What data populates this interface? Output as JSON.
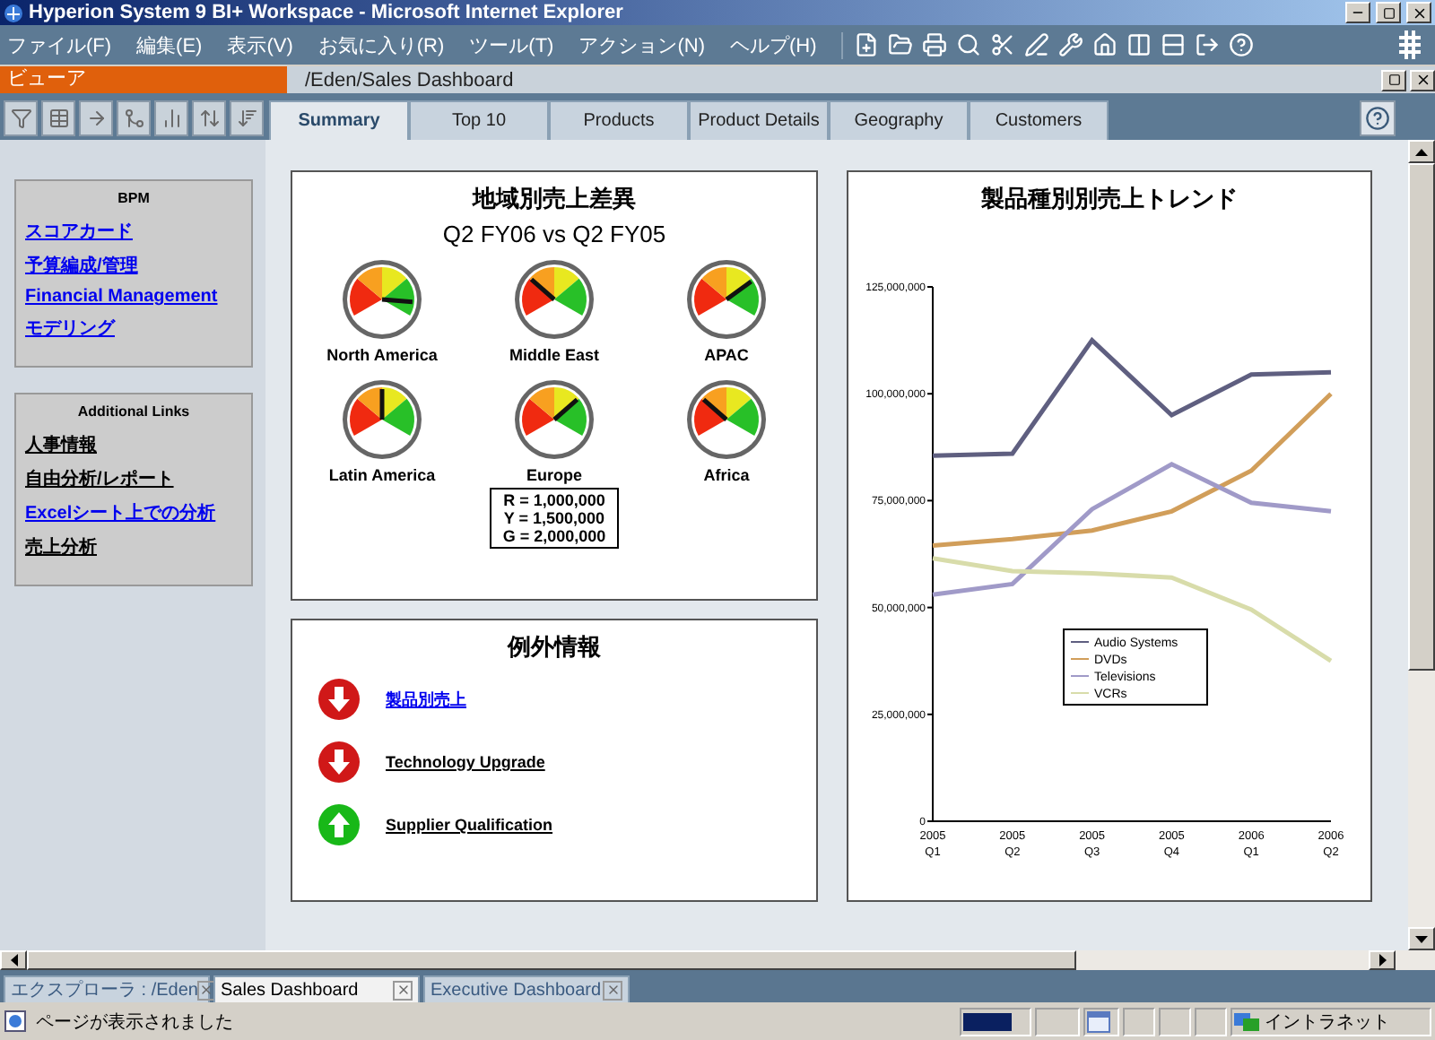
{
  "window": {
    "title": "Hyperion System 9 BI+ Workspace - Microsoft Internet Explorer"
  },
  "menu": [
    "ファイル(F)",
    "編集(E)",
    "表示(V)",
    "お気に入り(R)",
    "ツール(T)",
    "アクション(N)",
    "ヘルプ(H)"
  ],
  "viewer": {
    "label": "ビューア",
    "path": "/Eden/Sales Dashboard"
  },
  "tabs": [
    {
      "label": "Summary",
      "selected": true
    },
    {
      "label": "Top 10",
      "selected": false
    },
    {
      "label": "Products",
      "selected": false
    },
    {
      "label": "Product Details",
      "selected": false
    },
    {
      "label": "Geography",
      "selected": false
    },
    {
      "label": "Customers",
      "selected": false
    }
  ],
  "sidebar": [
    {
      "title": "BPM",
      "links": [
        {
          "label": "スコアカード",
          "color": "#0000ee"
        },
        {
          "label": "予算編成/管理",
          "color": "#0000ee"
        },
        {
          "label": "Financial Management",
          "color": "#0000ee"
        },
        {
          "label": "モデリング",
          "color": "#0000ee"
        }
      ]
    },
    {
      "title": "Additional Links",
      "links": [
        {
          "label": "人事情報",
          "color": "#000000"
        },
        {
          "label": "自由分析/レポート",
          "color": "#000000"
        },
        {
          "label": "Excelシート上での分析",
          "color": "#0000ee"
        },
        {
          "label": "売上分析",
          "color": "#000000"
        }
      ]
    }
  ],
  "gauge_panel": {
    "title": "地域別売上差異",
    "subtitle": "Q2 FY06 vs Q2 FY05",
    "gauges": [
      {
        "label": "North America"
      },
      {
        "label": "Middle East"
      },
      {
        "label": "APAC"
      },
      {
        "label": "Latin America"
      },
      {
        "label": "Europe"
      },
      {
        "label": "Africa"
      }
    ],
    "legend": [
      "R = 1,000,000",
      "Y = 1,500,000",
      "G = 2,000,000"
    ]
  },
  "exceptions": {
    "title": "例外情報",
    "items": [
      {
        "label": "製品別売上",
        "kind": "down",
        "color": "#0000ee"
      },
      {
        "label": "Technology Upgrade",
        "kind": "down",
        "color": "#000000"
      },
      {
        "label": "Supplier Qualification",
        "kind": "up",
        "color": "#000000"
      }
    ]
  },
  "chart_panel": {
    "chart_data": {
      "type": "line",
      "title": "製品種別別売上トレンド",
      "categories": [
        "2005 Q1",
        "2005 Q2",
        "2005 Q3",
        "2005 Q4",
        "2006 Q1",
        "2006 Q2"
      ],
      "series": [
        {
          "name": "Audio Systems",
          "color": "#5f5f80",
          "values": [
            85500000,
            86000000,
            112500000,
            95000000,
            104500000,
            105000000
          ]
        },
        {
          "name": "DVDs",
          "color": "#d19e5a",
          "values": [
            64500000,
            66000000,
            68000000,
            72500000,
            82000000,
            100000000
          ]
        },
        {
          "name": "Televisions",
          "color": "#a09ac8",
          "values": [
            53000000,
            55500000,
            73000000,
            83500000,
            74500000,
            72500000
          ]
        },
        {
          "name": "VCRs",
          "color": "#d8dcaa",
          "values": [
            61500000,
            58500000,
            58000000,
            57000000,
            49500000,
            37500000
          ]
        }
      ],
      "ylim": [
        0,
        125000000
      ],
      "legend": true,
      "yticks": [
        {
          "value": 0,
          "label": "0"
        },
        {
          "value": 25000000,
          "label": "25,000,000"
        },
        {
          "value": 50000000,
          "label": "50,000,000"
        },
        {
          "value": 75000000,
          "label": "75,000,000"
        },
        {
          "value": 100000000,
          "label": "100,000,000"
        },
        {
          "value": 125000000,
          "label": "125,000,000"
        }
      ]
    }
  },
  "doc_tabs": [
    {
      "label": "エクスプローラ : /Eden",
      "selected": false
    },
    {
      "label": "Sales Dashboard",
      "selected": true
    },
    {
      "label": "Executive Dashboard",
      "selected": false
    }
  ],
  "status_bar": {
    "message": "ページが表示されました",
    "zone": "イントラネット"
  }
}
